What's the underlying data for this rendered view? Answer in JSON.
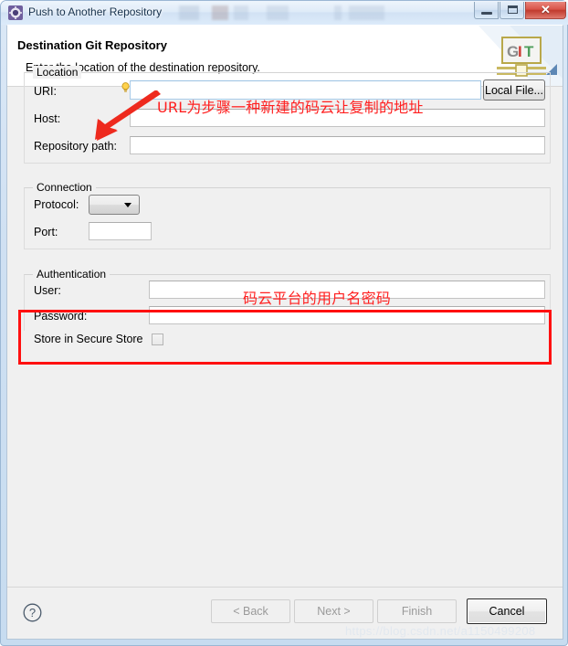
{
  "window": {
    "title": "Push to Another Repository",
    "icon": "eclipse-gear-icon",
    "minimize_label": "",
    "maximize_label": "",
    "close_label": "✕"
  },
  "header": {
    "title": "Destination Git Repository",
    "description": "Enter the location of the destination repository.",
    "banner_icon": "git-banner-icon",
    "banner_letters": [
      "G",
      "I",
      "T"
    ]
  },
  "location": {
    "group_label": "Location",
    "uri_label": "URI:",
    "uri_value": "",
    "uri_placeholder": "",
    "uri_hint_icon": "lightbulb-content-assist-icon",
    "local_file_button": "Local File...",
    "host_label": "Host:",
    "host_value": "",
    "repository_path_label": "Repository path:",
    "repository_path_value": ""
  },
  "connection": {
    "group_label": "Connection",
    "protocol_label": "Protocol:",
    "protocol_value": "",
    "port_label": "Port:",
    "port_value": ""
  },
  "authentication": {
    "group_label": "Authentication",
    "user_label": "User:",
    "user_value": "",
    "password_label": "Password:",
    "password_value": "",
    "store_label": "Store in Secure Store",
    "store_checked": false
  },
  "buttons": {
    "help": "?",
    "back": "< Back",
    "next": "Next >",
    "finish": "Finish",
    "cancel": "Cancel"
  },
  "annotations": {
    "url_note": "URL为步骤一种新建的码云让复制的地址",
    "auth_note": "码云平台的用户名密码",
    "arrow_icon": "red-arrow-icon",
    "box_icon": "red-highlight-box",
    "color": "#ff1010"
  },
  "watermark": {
    "text": "https://blog.csdn.net/a1150499208"
  }
}
